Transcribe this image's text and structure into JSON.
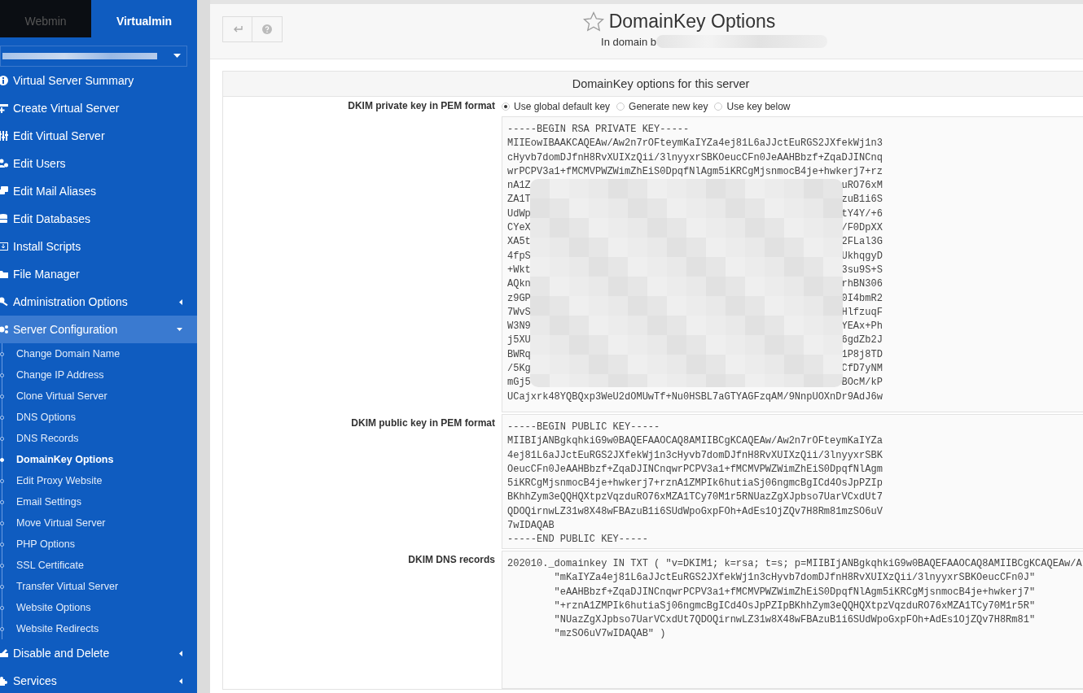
{
  "sidebar": {
    "tabs": [
      {
        "label": "Webmin",
        "selected": false
      },
      {
        "label": "Virtualmin",
        "selected": true
      }
    ],
    "menu": [
      {
        "label": "Virtual Server Summary"
      },
      {
        "label": "Create Virtual Server"
      },
      {
        "label": "Edit Virtual Server"
      },
      {
        "label": "Edit Users"
      },
      {
        "label": "Edit Mail Aliases"
      },
      {
        "label": "Edit Databases"
      },
      {
        "label": "Install Scripts"
      },
      {
        "label": "File Manager"
      },
      {
        "label": "Administration Options",
        "expanded": false
      },
      {
        "label": "Server Configuration",
        "expanded": true,
        "children": [
          {
            "label": "Change Domain Name",
            "selected": false
          },
          {
            "label": "Change IP Address",
            "selected": false
          },
          {
            "label": "Clone Virtual Server",
            "selected": false
          },
          {
            "label": "DNS Options",
            "selected": false
          },
          {
            "label": "DNS Records",
            "selected": false
          },
          {
            "label": "DomainKey Options",
            "selected": true
          },
          {
            "label": "Edit Proxy Website",
            "selected": false
          },
          {
            "label": "Email Settings",
            "selected": false
          },
          {
            "label": "Move Virtual Server",
            "selected": false
          },
          {
            "label": "PHP Options",
            "selected": false
          },
          {
            "label": "SSL Certificate",
            "selected": false
          },
          {
            "label": "Transfer Virtual Server",
            "selected": false
          },
          {
            "label": "Website Options",
            "selected": false
          },
          {
            "label": "Website Redirects",
            "selected": false
          }
        ]
      },
      {
        "label": "Disable and Delete",
        "expanded": false
      },
      {
        "label": "Services",
        "expanded": false
      }
    ]
  },
  "header": {
    "title": "DomainKey Options",
    "subtitle": "In domain b"
  },
  "form": {
    "heading": "DomainKey options for this server",
    "rows": [
      {
        "kind": "radio",
        "label": "DKIM private key in PEM format",
        "options": [
          {
            "label": "Use global default key",
            "selected": true
          },
          {
            "label": "Generate new key",
            "selected": false
          },
          {
            "label": "Use key below",
            "selected": false
          }
        ]
      },
      {
        "kind": "text",
        "label": "",
        "lines": [
          {
            "kind": "full",
            "text": "-----BEGIN RSA PRIVATE KEY-----"
          },
          {
            "kind": "full",
            "text": "MIIEowIBAAKCAQEAw/Aw2n7rOFteymKaIYZa4ej81L6aJJctEuRGS2JXfekWj1n3"
          },
          {
            "kind": "full",
            "text": "cHyvb7domDJfnH8RvXUIXzQii/3lnyyxrSBKOeucCFn0JeAAHBbzf+ZqaDJINCnq"
          },
          {
            "kind": "full",
            "text": "wrPCPV3a1+fMCMVPWZWimZhEiS0DpqfNlAgm5iKRCgMjsnmocB4je+hwkerj7+rz"
          },
          {
            "kind": "redacted",
            "start": "nA1Z",
            "end": "uRO76xM"
          },
          {
            "kind": "redacted",
            "start": "ZA1T",
            "end": "zuB1i6S"
          },
          {
            "kind": "redacted",
            "start": "UdWp",
            "end": "tY4Y/+6"
          },
          {
            "kind": "redacted",
            "start": "CYeX",
            "end": "/F0DpXX"
          },
          {
            "kind": "redacted",
            "start": "XA5t",
            "end": "2FLal3G"
          },
          {
            "kind": "redacted",
            "start": "4fpS",
            "end": "UkhqgyD"
          },
          {
            "kind": "redacted",
            "start": "+Wkt",
            "end": "3su9S+S"
          },
          {
            "kind": "redacted",
            "start": "AQkn",
            "end": "rhBN306"
          },
          {
            "kind": "redacted",
            "start": "z9GP",
            "end": "0I4bmR2"
          },
          {
            "kind": "redacted",
            "start": "7WvS",
            "end": "HlfzuqF"
          },
          {
            "kind": "redacted",
            "start": "W3N9",
            "end": "YEAx+Ph"
          },
          {
            "kind": "redacted",
            "start": "j5XU",
            "end": "6gdZb2J"
          },
          {
            "kind": "redacted",
            "start": "BWRq",
            "end": "1P8j8TD"
          },
          {
            "kind": "redacted",
            "start": "/5Kg",
            "end": "CfD7yNM"
          },
          {
            "kind": "redacted",
            "start": "mGj5",
            "end": "BOcM/kP"
          },
          {
            "kind": "full",
            "text": "UCajxrk48YQBQxp3WeU2dOMUwTf+Nu0HSBL7aGTYAGFzqAM/9NnpUOXnDr9AdJ6w"
          }
        ]
      },
      {
        "kind": "text",
        "label": "DKIM public key in PEM format",
        "lines": [
          {
            "kind": "full",
            "text": "-----BEGIN PUBLIC KEY-----"
          },
          {
            "kind": "full",
            "text": "MIIBIjANBgkqhkiG9w0BAQEFAAOCAQ8AMIIBCgKCAQEAw/Aw2n7rOFteymKaIYZa"
          },
          {
            "kind": "full",
            "text": "4ej81L6aJJctEuRGS2JXfekWj1n3cHyvb7domDJfnH8RvXUIXzQii/3lnyyxrSBK"
          },
          {
            "kind": "full",
            "text": "OeucCFn0JeAAHBbzf+ZqaDJINCnqwrPCPV3a1+fMCMVPWZWimZhEiS0DpqfNlAgm"
          },
          {
            "kind": "full",
            "text": "5iKRCgMjsnmocB4je+hwkerj7+rznA1ZMPIk6hutiaSj06ngmcBgICd4OsJpPZIp"
          },
          {
            "kind": "full",
            "text": "BKhhZym3eQQHQXtpzVqzduRO76xMZA1TCy70M1r5RNUazZgXJpbso7UarVCxdUt7"
          },
          {
            "kind": "full",
            "text": "QDOQirnwLZ31w8X48wFBAzuB1i6SUdWpoGxpFOh+AdEs1OjZQv7H8Rm81mzSO6uV"
          },
          {
            "kind": "full",
            "text": "7wIDAQAB"
          },
          {
            "kind": "full",
            "text": "-----END PUBLIC KEY-----"
          }
        ]
      },
      {
        "kind": "text",
        "label": "DKIM DNS records",
        "lines": [
          {
            "kind": "full",
            "text": "202010._domainkey IN TXT ( \"v=DKIM1; k=rsa; t=s; p=MIIBIjANBgkqhkiG9w0BAQEFAAOCAQ8AMIIBCgKCAQEAw/A"
          },
          {
            "kind": "full",
            "text": "\t\"mKaIYZa4ej81L6aJJctEuRGS2JXfekWj1n3cHyvb7domDJfnH8RvXUIXzQii/3lnyyxrSBKOeucCFn0J\""
          },
          {
            "kind": "full",
            "text": "\t\"eAAHBbzf+ZqaDJINCnqwrPCPV3a1+fMCMVPWZWimZhEiS0DpqfNlAgm5iKRCgMjsnmocB4je+hwkerj7\""
          },
          {
            "kind": "full",
            "text": "\t\"+rznA1ZMPIk6hutiaSj06ngmcBgICd4OsJpPZIpBKhhZym3eQQHQXtpzVqzduRO76xMZA1TCy70M1r5R\""
          },
          {
            "kind": "full",
            "text": "\t\"NUazZgXJpbso7UarVCxdUt7QDOQirnwLZ31w8X48wFBAzuB1i6SUdWpoGxpFOh+AdEs1OjZQv7H8Rm81\""
          },
          {
            "kind": "full",
            "text": "\t\"mzSO6uV7wIDAQAB\" )"
          }
        ]
      }
    ]
  }
}
